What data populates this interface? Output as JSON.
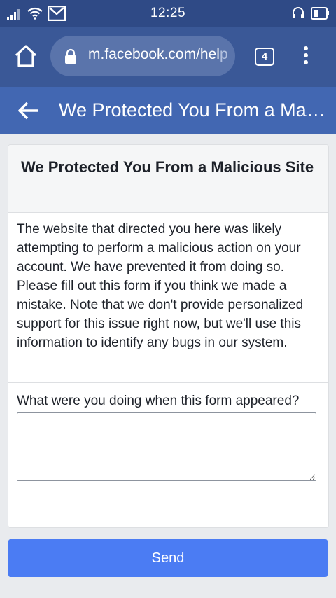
{
  "status_bar": {
    "time": "12:25",
    "icons": [
      "signal-icon",
      "wifi-icon",
      "gmail-icon",
      "headset-icon",
      "battery-icon"
    ]
  },
  "browser": {
    "url_main": "m.facebook.com/hel",
    "url_faded": "p",
    "tab_count": "4"
  },
  "header": {
    "title": "We Protected You From a Malicious Site"
  },
  "card": {
    "title": "We Protected You From a Malicious Site",
    "description": "The website that directed you here was likely attempting to perform a malicious action on your account. We have prevented it from doing so. Please fill out this form if you think we made a mistake. Note that we don't provide personalized support for this issue right now, but we'll use this information to identify any bugs in our system.",
    "form_label": "What were you doing when this form appeared?",
    "textarea_value": ""
  },
  "send_label": "Send",
  "colors": {
    "status_bar": "#2f4a86",
    "browser_bar": "#3a5897",
    "header_bar": "#4267b2",
    "send_button": "#4b7cf3",
    "page_bg": "#e9ebee"
  }
}
